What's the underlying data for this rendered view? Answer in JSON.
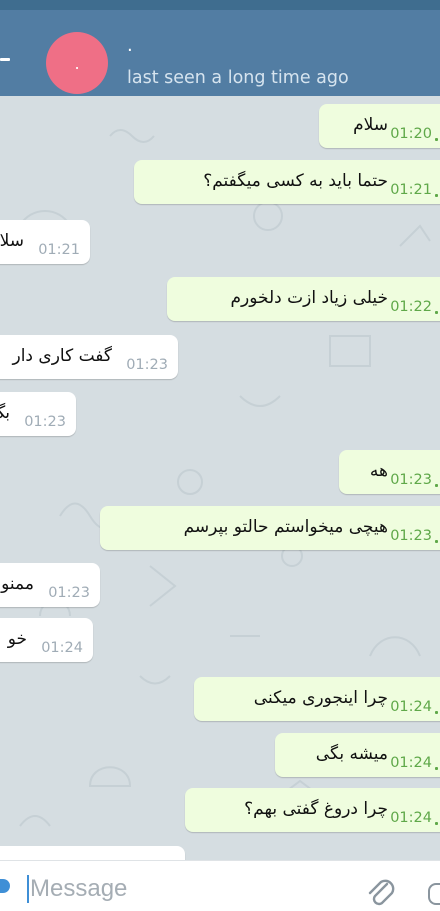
{
  "header": {
    "contact_name": ".",
    "avatar_initial": ".",
    "status": "last seen a long time ago"
  },
  "messages": [
    {
      "direction": "out",
      "text": "سلام",
      "time": "01:20"
    },
    {
      "direction": "out",
      "text": "حتما باید به کسی میگفتم؟",
      "time": "01:21"
    },
    {
      "direction": "in",
      "text": "سلا",
      "time": "01:21"
    },
    {
      "direction": "out",
      "text": "خیلی زیاد ازت دلخورم",
      "time": "01:22"
    },
    {
      "direction": "in",
      "text": "گفت کاری دار",
      "time": "01:23"
    },
    {
      "direction": "in",
      "text": "بگ",
      "time": "01:23"
    },
    {
      "direction": "out",
      "text": "هه",
      "time": "01:23"
    },
    {
      "direction": "out",
      "text": "هیچی میخواستم حالتو بپرسم",
      "time": "01:23"
    },
    {
      "direction": "in",
      "text": "ممنو",
      "time": "01:23"
    },
    {
      "direction": "in",
      "text": "خو",
      "time": "01:24"
    },
    {
      "direction": "out",
      "text": "چرا اینجوری میکنی",
      "time": "01:24"
    },
    {
      "direction": "out",
      "text": "میشه بگی",
      "time": "01:24"
    },
    {
      "direction": "out",
      "text": "چرا دروغ گفتی بهم؟",
      "time": "01:24"
    },
    {
      "direction": "in",
      "text": "",
      "time": ""
    }
  ],
  "input": {
    "placeholder": "Message"
  },
  "colors": {
    "header": "#527da3",
    "outgoing_bubble": "#effdde",
    "incoming_bubble": "#ffffff",
    "time_outgoing": "#5fa849",
    "avatar": "#ef6f86"
  },
  "icons": {
    "back": "back-arrow-icon",
    "emoji": "emoji-icon",
    "attach": "paperclip-icon",
    "mic": "microphone-icon"
  }
}
